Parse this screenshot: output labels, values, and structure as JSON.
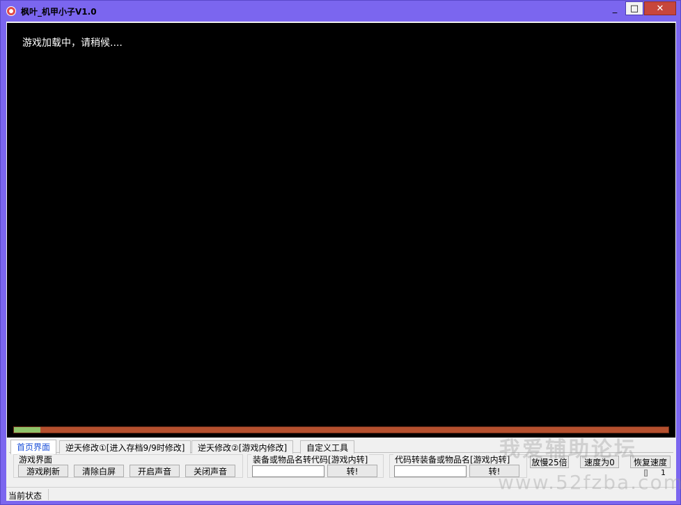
{
  "window": {
    "title": "枫叶_机甲小子V1.0",
    "minimize_label": "_",
    "maximize_label": "□",
    "close_label": "✕"
  },
  "game": {
    "loading_text": "游戏加载中，请稍候....",
    "progress_fraction": 0.04
  },
  "tabs": [
    {
      "label": "首页界面",
      "active": true
    },
    {
      "label": "逆天修改①[进入存档9/9时修改]",
      "active": false
    },
    {
      "label": "逆天修改②[游戏内修改]",
      "active": false
    },
    {
      "label": "自定义工具",
      "active": false
    }
  ],
  "group_game": {
    "label": "游戏界面",
    "buttons": [
      "游戏刷新",
      "清除白屏",
      "开启声音",
      "关闭声音"
    ]
  },
  "group_item_to_code": {
    "label": "装备或物品名转代码[游戏内转]",
    "input_value": "",
    "button": "转!"
  },
  "group_code_to_item": {
    "label": "代码转装备或物品名[游戏内转]",
    "input_value": "",
    "button": "转!"
  },
  "speed": {
    "slow_button": "放慢25倍",
    "zero_button": "速度为0",
    "restore_button": "恢复速度",
    "value": "1"
  },
  "status": {
    "text": "当前状态"
  },
  "watermark": {
    "line1": "我爱辅助论坛",
    "line2": "www.52fzba.com"
  },
  "colors": {
    "titlebar": "#7b66ef",
    "close": "#c7463c",
    "progress_track": "#b5502e",
    "progress_fill": "#8fc36a",
    "active_tab_text": "#1a4fd8"
  }
}
